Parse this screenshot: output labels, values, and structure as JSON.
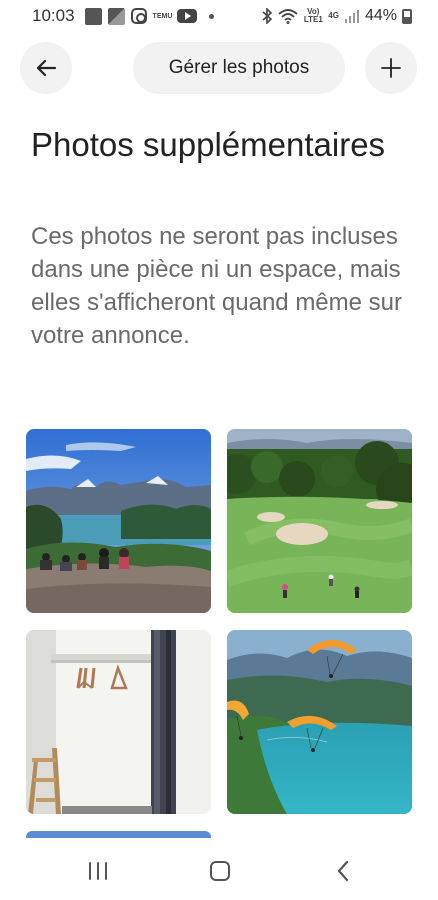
{
  "status_bar": {
    "time": "10:03",
    "temu_label": "TEMU",
    "network_label": "Vo) LTE1",
    "network_type": "4G",
    "battery": "44%"
  },
  "header": {
    "title": "Gérer les photos",
    "back_icon": "arrow-left-icon",
    "add_icon": "plus-icon"
  },
  "main": {
    "heading": "Photos supplémentaires",
    "description": "Ces photos ne seront pas incluses dans une pièce ni un espace, mais elles s'afficheront quand même sur votre annonce."
  },
  "photos": [
    {
      "subject": "lake-viewpoint"
    },
    {
      "subject": "golf-course"
    },
    {
      "subject": "coat-rack-entry"
    },
    {
      "subject": "paragliders-over-lake"
    }
  ],
  "nav_bar": {
    "recents_icon": "recents-icon",
    "home_icon": "home-icon",
    "back_icon": "back-chevron-icon"
  }
}
